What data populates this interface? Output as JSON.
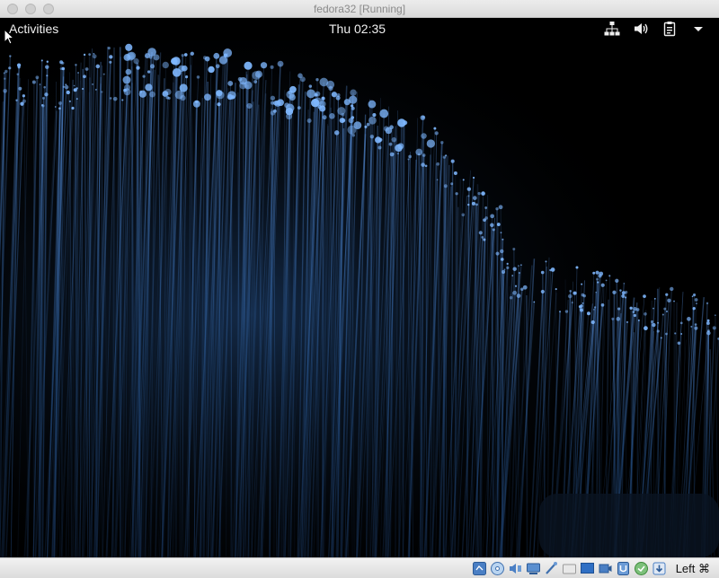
{
  "window": {
    "title": "fedora32 [Running]"
  },
  "topbar": {
    "activities_label": "Activities",
    "clock": "Thu 02:35",
    "tray_icons": [
      "network-icon",
      "volume-icon",
      "clipboard-battery-icon",
      "dropdown-arrow-icon"
    ]
  },
  "statusbar": {
    "icons": [
      "hard-disk-icon",
      "optical-drive-icon",
      "audio-icon",
      "network-icon",
      "usb-icon",
      "shared-folders-icon",
      "display-icon",
      "video-capture-icon",
      "virtualization-icon",
      "mouse-integration-icon",
      "host-key-icon"
    ],
    "host_key": "Left ⌘"
  },
  "colors": {
    "fiber_blue": "#3f7fd6",
    "fiber_glow": "#7fb8ff",
    "topbar_bg": "#000000"
  }
}
